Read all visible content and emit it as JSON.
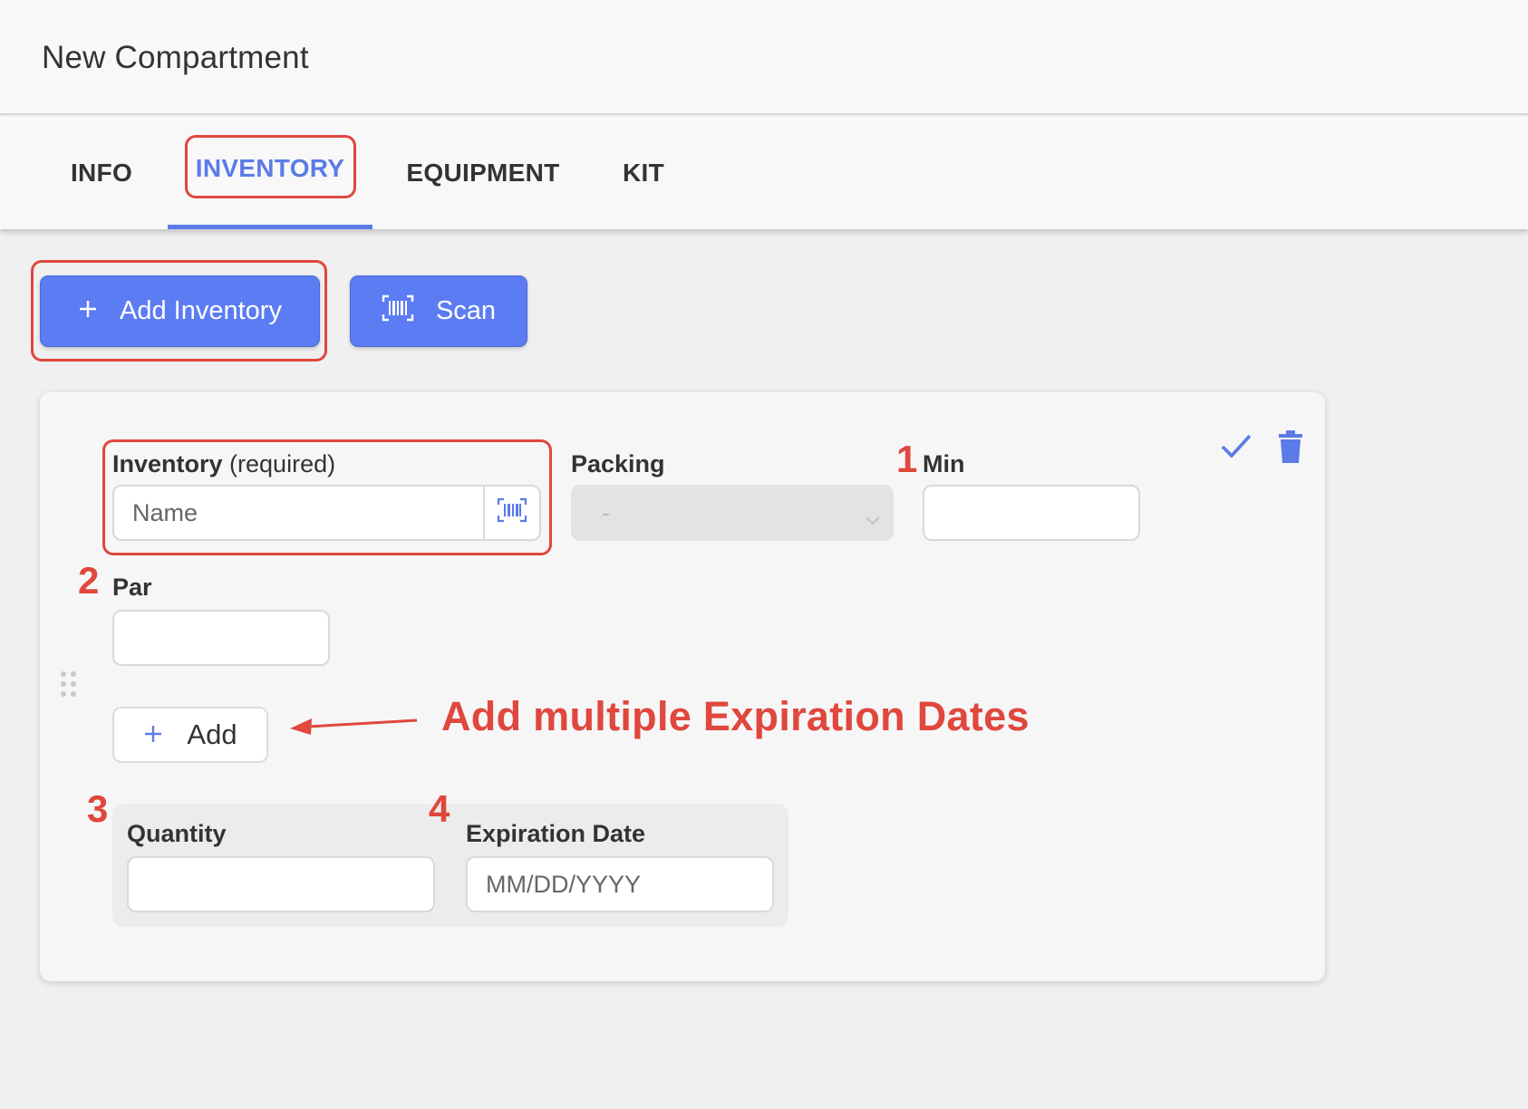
{
  "header": {
    "title": "New Compartment"
  },
  "tabs": [
    {
      "label": "INFO"
    },
    {
      "label": "INVENTORY"
    },
    {
      "label": "EQUIPMENT"
    },
    {
      "label": "KIT"
    }
  ],
  "toolbar": {
    "add_inventory_label": "Add Inventory",
    "scan_label": "Scan"
  },
  "form": {
    "inventory_label": "Inventory",
    "inventory_required": "(required)",
    "inventory_placeholder": "Name",
    "packing_label": "Packing",
    "packing_value": "-",
    "min_label": "Min",
    "par_label": "Par",
    "add_label": "Add",
    "quantity_label": "Quantity",
    "expiration_label": "Expiration Date",
    "expiration_placeholder": "MM/DD/YYYY"
  },
  "annotations": {
    "n1": "1",
    "n2": "2",
    "n3": "3",
    "n4": "4",
    "note": "Add multiple Expiration Dates"
  },
  "colors": {
    "accent": "#5b7be8",
    "button": "#5b7cf2",
    "annotation": "#e0473d"
  },
  "icons": [
    "plus-icon",
    "barcode-icon",
    "check-icon",
    "trash-icon",
    "drag-handle-icon",
    "chevron-down-icon"
  ]
}
